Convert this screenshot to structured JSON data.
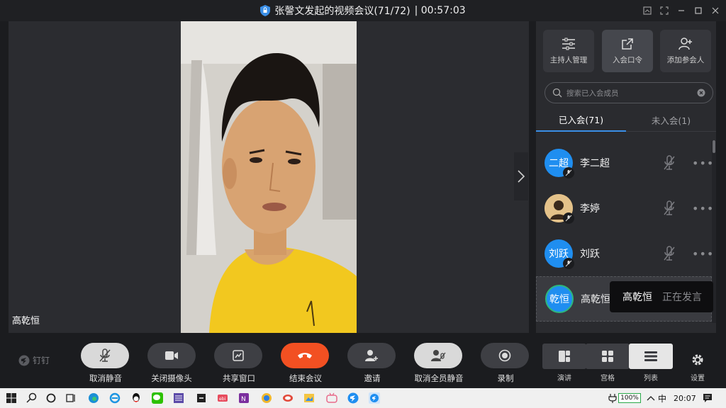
{
  "window": {
    "title": "张謦文发起的视频会议(71/72)",
    "timer": "| 00:57:03"
  },
  "video": {
    "speaker_name": "高乾恒"
  },
  "panel": {
    "buttons": [
      {
        "label": "主持人管理",
        "icon": "sliders-icon"
      },
      {
        "label": "入会口令",
        "icon": "share-link-icon"
      },
      {
        "label": "添加参会人",
        "icon": "add-person-icon"
      }
    ],
    "search_placeholder": "搜索已入会成员",
    "tabs": {
      "joined": "已入会(71)",
      "not_joined": "未入会(1)"
    },
    "members": [
      {
        "avatar_text": "二超",
        "name": "李二超",
        "avatar_color": "#1f8ef0"
      },
      {
        "avatar_text": "",
        "name": "李婷",
        "avatar_color": "#c9a46a"
      },
      {
        "avatar_text": "刘跃",
        "name": "刘跃",
        "avatar_color": "#1f8ef0"
      },
      {
        "avatar_text": "乾恒",
        "name": "高乾恒",
        "avatar_color": "#1f8ef0"
      }
    ],
    "speaking_tip": {
      "name": "高乾恒",
      "status": "正在发言"
    }
  },
  "toolbar": {
    "brand": "钉钉",
    "buttons": [
      {
        "label": "取消静音",
        "icon": "mic-muted-icon"
      },
      {
        "label": "关闭摄像头",
        "icon": "camera-icon"
      },
      {
        "label": "共享窗口",
        "icon": "share-screen-icon"
      },
      {
        "label": "结束会议",
        "icon": "hang-up-icon"
      },
      {
        "label": "邀请",
        "icon": "invite-person-icon"
      },
      {
        "label": "取消全员静音",
        "icon": "mute-all-icon"
      },
      {
        "label": "录制",
        "icon": "record-icon"
      }
    ],
    "views": [
      {
        "label": "演讲",
        "icon": "speaker-view-icon"
      },
      {
        "label": "宫格",
        "icon": "grid-view-icon"
      },
      {
        "label": "列表",
        "icon": "list-view-icon"
      }
    ],
    "settings_label": "设置"
  },
  "taskbar": {
    "battery": "100%",
    "ime": "中",
    "time": "20:07"
  },
  "colors": {
    "accent_blue": "#1f8ef0",
    "end_call": "#f25022",
    "tab_underline": "#3a8ee6"
  }
}
